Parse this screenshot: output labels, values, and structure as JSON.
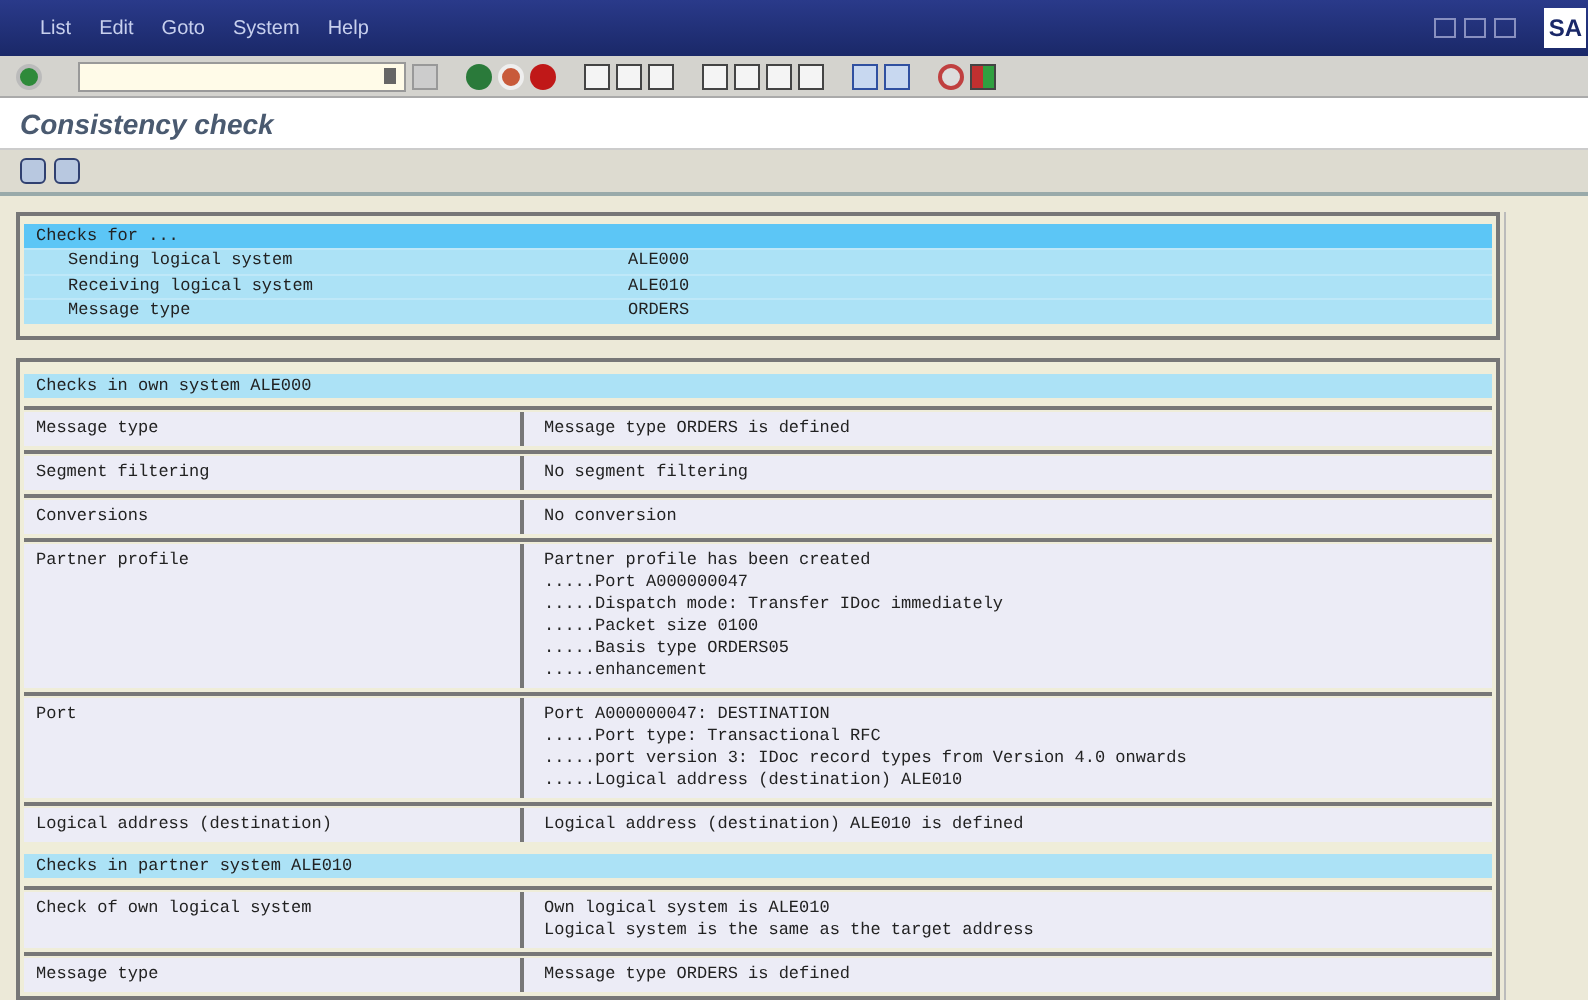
{
  "menu": [
    "List",
    "Edit",
    "Goto",
    "System",
    "Help"
  ],
  "logo": "SA",
  "title": "Consistency check",
  "checks_for": {
    "header": "Checks for ...",
    "items": [
      {
        "label": "Sending logical system",
        "value": "ALE000"
      },
      {
        "label": "Receiving logical system",
        "value": "ALE010"
      },
      {
        "label": "Message type",
        "value": "ORDERS"
      }
    ]
  },
  "sections": [
    {
      "title": "Checks in own system ALE000",
      "rows": [
        {
          "check": "Message type",
          "lines": [
            "Message type ORDERS is defined"
          ]
        },
        {
          "check": "Segment filtering",
          "lines": [
            "No segment filtering"
          ]
        },
        {
          "check": "Conversions",
          "lines": [
            "No conversion"
          ]
        },
        {
          "check": "Partner profile",
          "lines": [
            "Partner profile has been created",
            ".....Port A000000047",
            ".....Dispatch mode: Transfer IDoc immediately",
            ".....Packet size 0100",
            ".....Basis type ORDERS05",
            ".....enhancement"
          ]
        },
        {
          "check": "Port",
          "lines": [
            "Port A000000047: DESTINATION",
            ".....Port type: Transactional RFC",
            ".....port version 3: IDoc record types from Version 4.0 onwards",
            ".....Logical address (destination) ALE010"
          ]
        },
        {
          "check": "Logical address (destination)",
          "lines": [
            "Logical address (destination) ALE010 is defined"
          ]
        }
      ]
    },
    {
      "title": "Checks in partner system ALE010",
      "rows": [
        {
          "check": "Check of own logical system",
          "lines": [
            "Own logical system is ALE010",
            "Logical system is the same as the target address"
          ]
        },
        {
          "check": "Message type",
          "lines": [
            "Message type ORDERS is defined"
          ]
        }
      ]
    }
  ]
}
